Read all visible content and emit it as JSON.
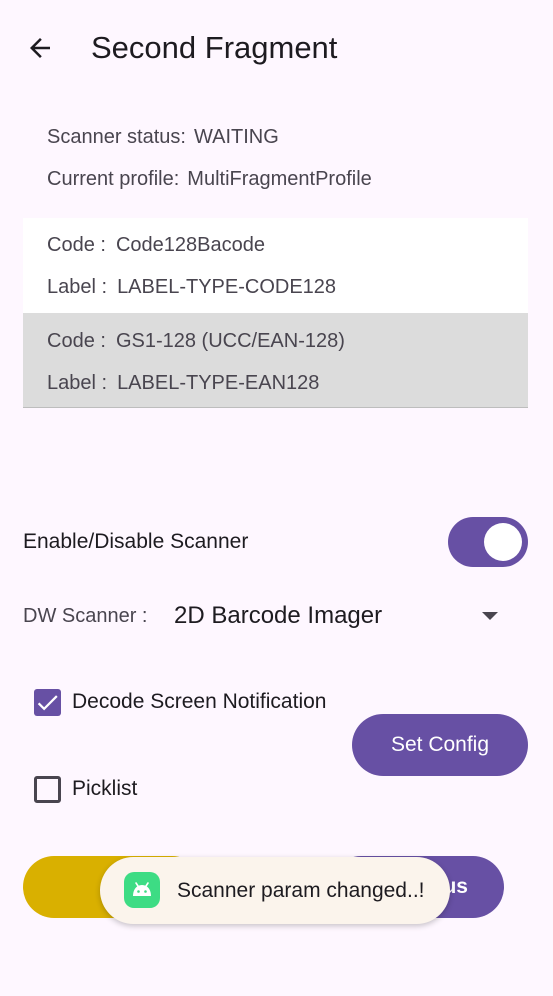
{
  "appbar": {
    "title": "Second Fragment",
    "back_icon": "arrow-back-icon"
  },
  "status": {
    "scanner_label": "Scanner status:",
    "scanner_value": "WAITING",
    "profile_label": "Current profile:",
    "profile_value": "MultiFragmentProfile"
  },
  "barcodes": [
    {
      "code_label": "Code :",
      "code_value": "Code128Bacode",
      "label_label": "Label :",
      "label_value": "LABEL-TYPE-CODE128",
      "selected": false
    },
    {
      "code_label": "Code :",
      "code_value": "GS1-128 (UCC/EAN-128)",
      "label_label": "Label :",
      "label_value": "LABEL-TYPE-EAN128",
      "selected": true
    }
  ],
  "scanner_switch": {
    "label": "Enable/Disable Scanner",
    "enabled": true
  },
  "dw_scanner": {
    "label": "DW Scanner :",
    "value": "2D Barcode Imager"
  },
  "options": {
    "decode_notification": {
      "label": "Decode Screen Notification",
      "checked": true
    },
    "picklist": {
      "label": "Picklist",
      "checked": false
    }
  },
  "buttons": {
    "set_config": "Set Config",
    "right_visible_text": "us"
  },
  "toast": {
    "message": "Scanner param changed..!",
    "icon": "android-icon"
  },
  "colors": {
    "primary": "#6750A4",
    "yellow": "#D9B000",
    "background": "#FEF7FF",
    "selected_row": "#DCDCDC",
    "android_green": "#3DDC84"
  }
}
